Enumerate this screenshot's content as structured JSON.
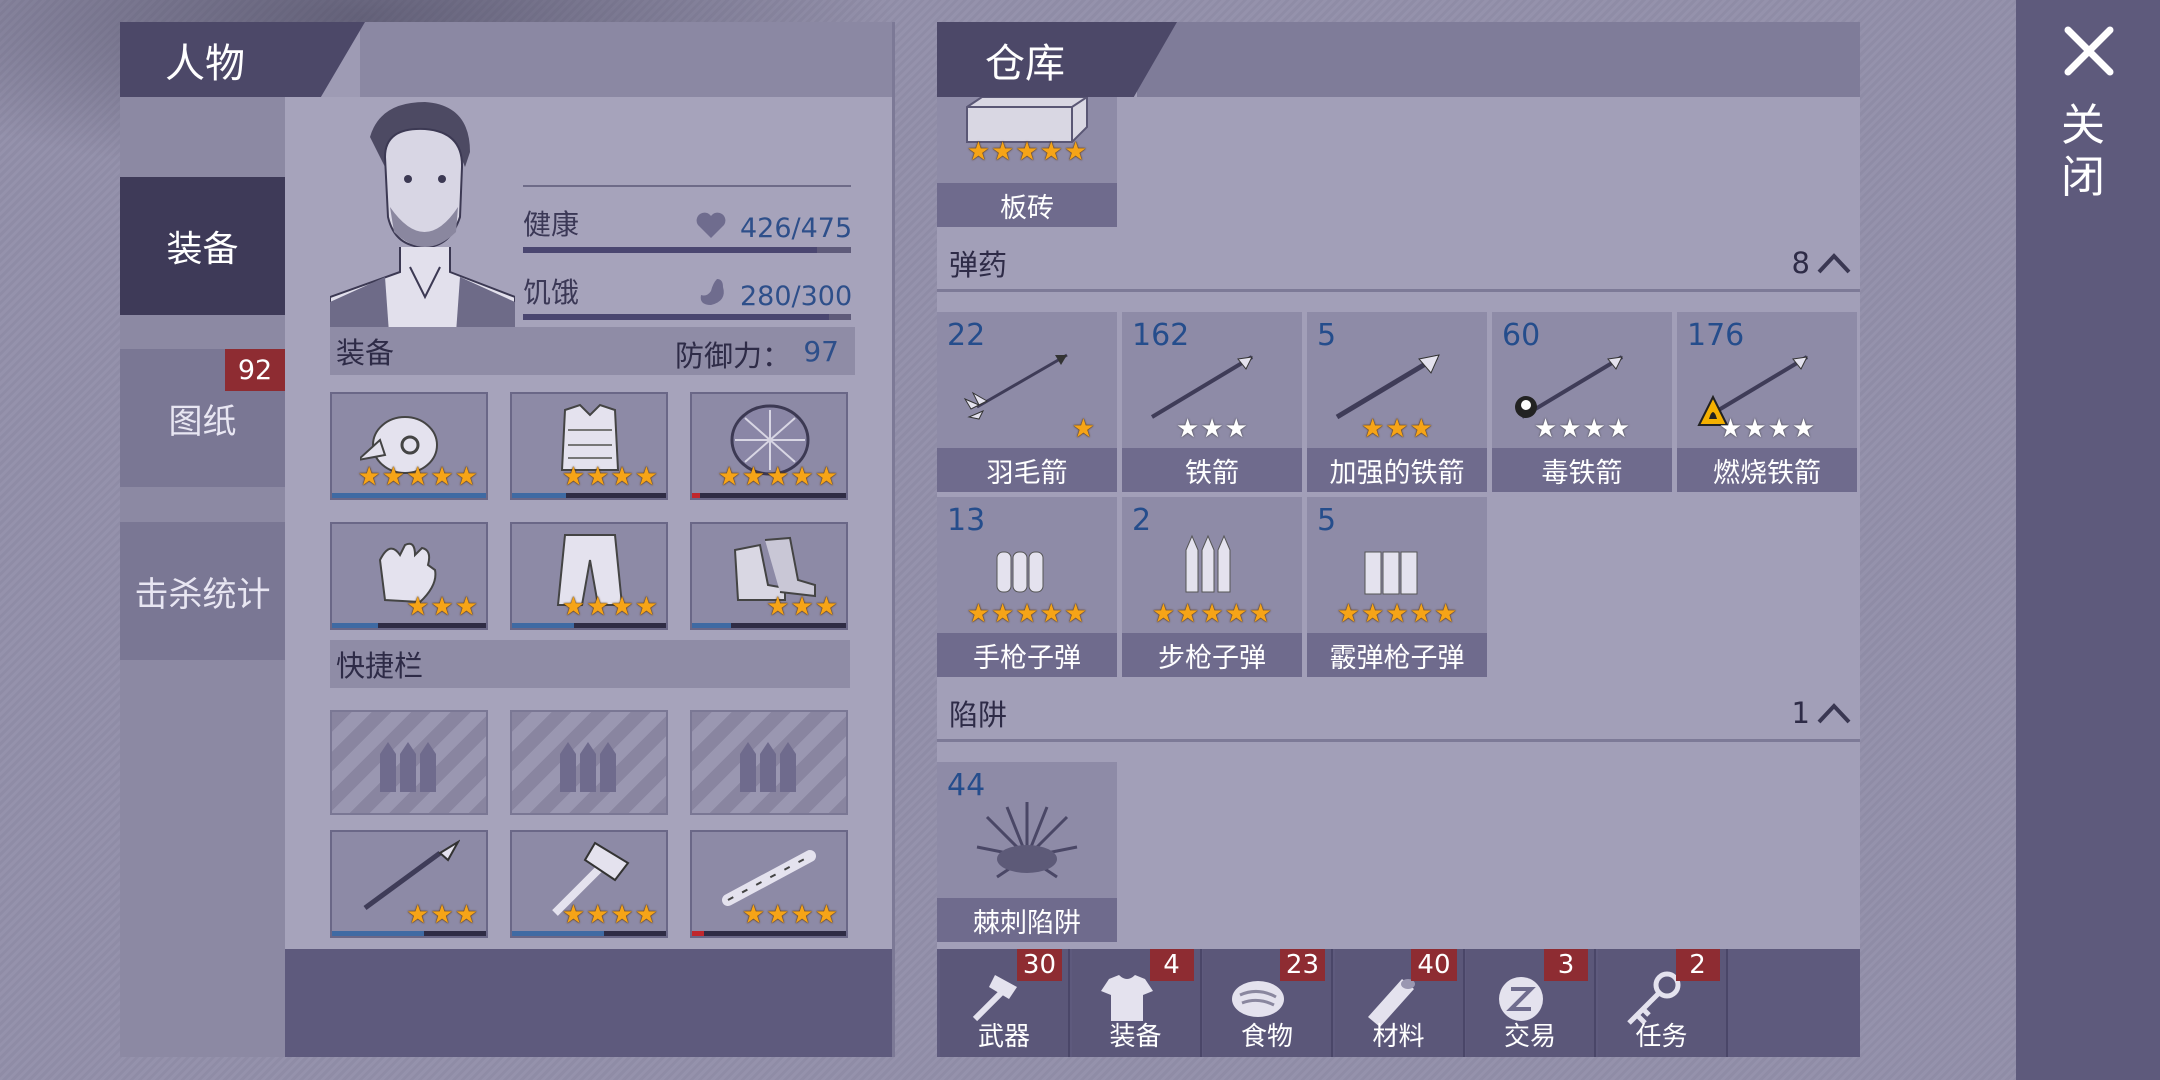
{
  "left_panel": {
    "title": "人物",
    "tabs": [
      {
        "label": "装备",
        "active": true
      },
      {
        "label": "图纸",
        "badge": "92"
      },
      {
        "label": "击杀统计"
      }
    ],
    "stats": {
      "health_label": "健康",
      "health_value": "426/475",
      "health_fraction": 0.897,
      "hunger_label": "饥饿",
      "hunger_value": "280/300",
      "hunger_fraction": 0.933
    },
    "equipment": {
      "header": "装备",
      "defense_label": "防御力：",
      "defense_value": "97",
      "slots": [
        {
          "icon": "bird-mask-helmet-icon",
          "stars": 5,
          "durability": 1.0
        },
        {
          "icon": "armor-vest-icon",
          "stars": 4,
          "durability": 0.35
        },
        {
          "icon": "turtle-shell-icon",
          "stars": 5,
          "durability": 0.05
        },
        {
          "icon": "gloves-icon",
          "stars": 3,
          "durability": 0.3
        },
        {
          "icon": "pants-icon",
          "stars": 4,
          "durability": 0.4
        },
        {
          "icon": "boots-icon",
          "stars": 3,
          "durability": 0.25
        }
      ]
    },
    "hotbar": {
      "header": "快捷栏",
      "empty_slots": 3,
      "weapons": [
        {
          "icon": "spear-icon",
          "stars": 3,
          "durability": 0.6
        },
        {
          "icon": "axe-icon",
          "stars": 4,
          "durability": 0.6
        },
        {
          "icon": "club-icon",
          "stars": 4,
          "durability": 0.08
        }
      ]
    }
  },
  "storage": {
    "title": "仓库",
    "top_item": {
      "name": "板砖",
      "stars": 5,
      "icon": "brick-icon"
    },
    "categories": [
      {
        "name": "弹药",
        "count": "8",
        "items": [
          {
            "qty": "22",
            "name": "羽毛箭",
            "stars": 1,
            "white": 0,
            "icon": "feather-arrow-icon"
          },
          {
            "qty": "162",
            "name": "铁箭",
            "stars": 0,
            "white": 3,
            "icon": "iron-arrow-icon"
          },
          {
            "qty": "5",
            "name": "加强的铁箭",
            "stars": 3,
            "white": 0,
            "icon": "reinforced-iron-arrow-icon"
          },
          {
            "qty": "60",
            "name": "毒铁箭",
            "stars": 0,
            "white": 4,
            "icon": "poison-iron-arrow-icon"
          },
          {
            "qty": "176",
            "name": "燃烧铁箭",
            "stars": 0,
            "white": 4,
            "icon": "fire-iron-arrow-icon"
          },
          {
            "qty": "13",
            "name": "手枪子弹",
            "stars": 5,
            "white": 0,
            "icon": "pistol-bullets-icon"
          },
          {
            "qty": "2",
            "name": "步枪子弹",
            "stars": 5,
            "white": 0,
            "icon": "rifle-bullets-icon"
          },
          {
            "qty": "5",
            "name": "霰弹枪子弹",
            "stars": 5,
            "white": 0,
            "icon": "shotgun-shells-icon"
          }
        ]
      },
      {
        "name": "陷阱",
        "count": "1",
        "items": [
          {
            "qty": "44",
            "name": "棘刺陷阱",
            "stars": 0,
            "white": 0,
            "icon": "spike-trap-icon"
          }
        ]
      }
    ],
    "bottom_tabs": [
      {
        "label": "武器",
        "count": "30",
        "icon": "axe-icon"
      },
      {
        "label": "装备",
        "count": "4",
        "icon": "shirt-icon"
      },
      {
        "label": "食物",
        "count": "23",
        "icon": "meat-icon"
      },
      {
        "label": "材料",
        "count": "40",
        "icon": "log-icon"
      },
      {
        "label": "交易",
        "count": "3",
        "icon": "coin-icon"
      },
      {
        "label": "任务",
        "count": "2",
        "icon": "key-icon"
      }
    ]
  },
  "close": {
    "label": "关闭"
  },
  "colors": {
    "accent_dark": "#3e3a58",
    "badge_red": "#8e2c32",
    "star_gold": "#f6a417",
    "qty_blue": "#254d8c"
  }
}
